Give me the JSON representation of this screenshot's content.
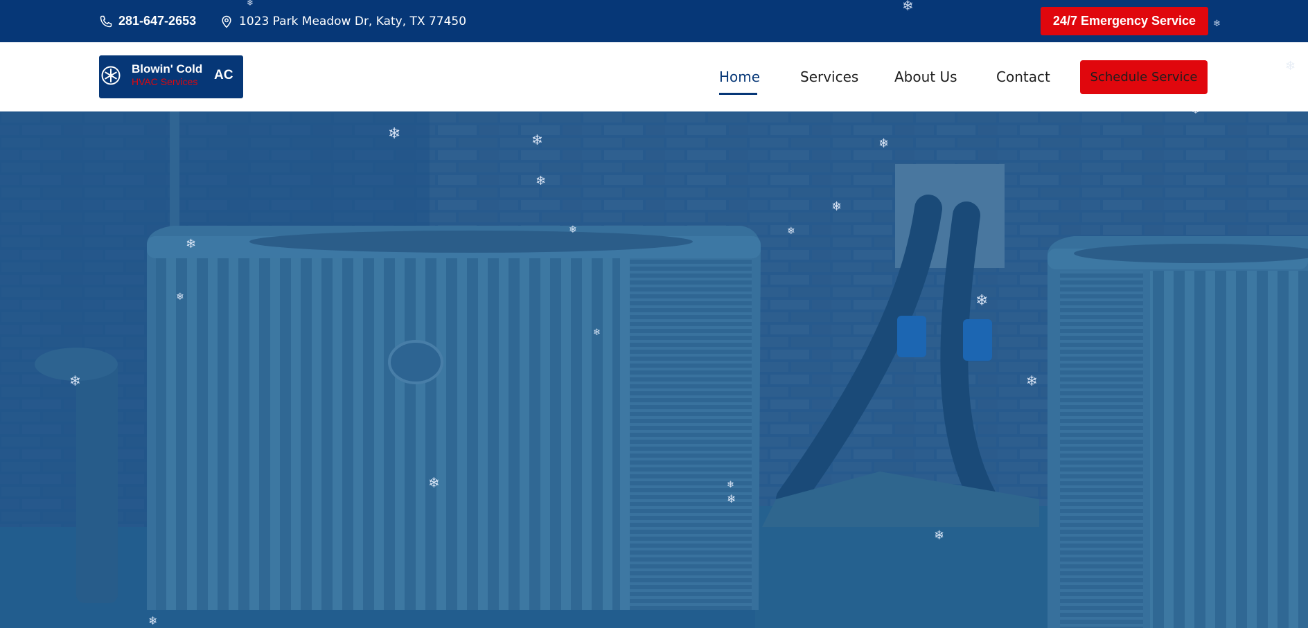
{
  "topbar": {
    "phone": "281-647-2653",
    "address": "1023 Park Meadow Dr, Katy, TX 77450",
    "emergency_label": "24/7 Emergency Service",
    "phone_icon": "phone-icon",
    "location_icon": "map-pin-icon"
  },
  "logo": {
    "name": "Blowin' Cold",
    "subtitle": "HVAC Services",
    "suffix": "AC",
    "icon": "snowflake-icon"
  },
  "nav": {
    "items": [
      {
        "label": "Home",
        "active": true
      },
      {
        "label": "Services",
        "active": false
      },
      {
        "label": "About Us",
        "active": false
      },
      {
        "label": "Contact",
        "active": false
      }
    ],
    "cta_label": "Schedule Service"
  },
  "snowflake_glyph": "❄",
  "colors": {
    "brand_navy": "#063777",
    "brand_red": "#e0070d",
    "hero_overlay": "#1f5a8f"
  }
}
